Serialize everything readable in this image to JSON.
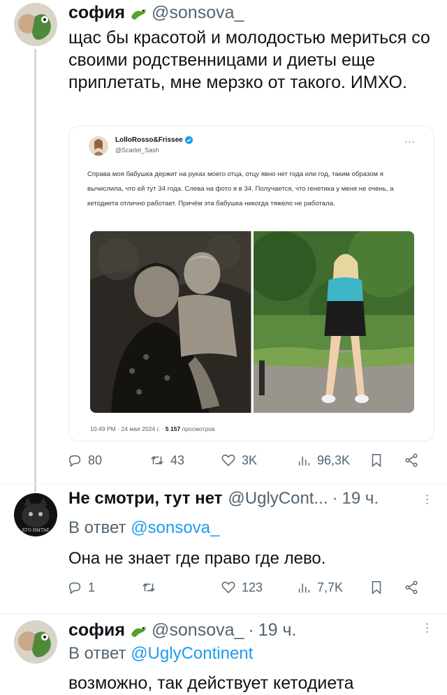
{
  "tweet1": {
    "name": "софия",
    "handle": "@sonsova_",
    "text": "щас бы красотой и молодостью мериться со своими родственницами и диеты еще приплетать, мне мерзко от такого. ИМХО.",
    "quote": {
      "name": "LolloRosso&Frissee",
      "handle": "@Scarlet_Sash",
      "more": "···",
      "text": "Справа моя бабушка держит на руках моего отца, отцу явно нет года или год, таким образом я вычислила, что ей тут 34 года. Слева на фото я в 34. Получается, что генетика у меня не очень, а кетодиета отлично работает. Причём эта бабушка никогда тяжело не работала.",
      "meta_time": "10:49 PM · 24 мая 2024 г. · ",
      "views_count": "5 157",
      "views_label": " просмотров"
    },
    "actions": {
      "replies": "80",
      "retweets": "43",
      "likes": "3K",
      "views": "96,3K"
    }
  },
  "tweet2": {
    "name": "Не смотри, тут нет",
    "handle": "@UglyCont...",
    "time": "19 ч.",
    "reply_prefix": "В ответ ",
    "reply_mention": "@sonsova_",
    "text": "Она не знает где право где лево.",
    "actions": {
      "replies": "1",
      "retweets": "",
      "likes": "123",
      "views": "7,7K"
    }
  },
  "tweet3": {
    "name": "софия",
    "handle": "@sonsova_",
    "time": "19 ч.",
    "reply_prefix": "В ответ ",
    "reply_mention": "@UglyContinent",
    "text": "возможно, так действует кетодиета"
  },
  "colors": {
    "accent": "#1d9bf0",
    "muted": "#536471",
    "text": "#0f1419",
    "line": "#cfd9de"
  }
}
